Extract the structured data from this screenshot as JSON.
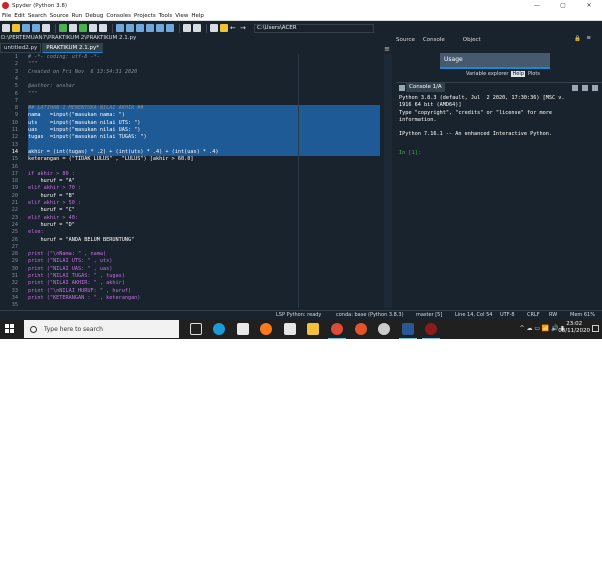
{
  "window": {
    "title": "Spyder (Python 3.8)",
    "minimize": "—",
    "maximize": "▢",
    "close": "✕"
  },
  "menu": [
    "File",
    "Edit",
    "Search",
    "Source",
    "Run",
    "Debug",
    "Consoles",
    "Projects",
    "Tools",
    "View",
    "Help"
  ],
  "toolbar": {
    "path": "C:\\Users\\ACER",
    "back": "←",
    "forward": "→"
  },
  "editor": {
    "file_path": "D:\\PERTEMUAN7\\PRAKTIKUM 2\\PRAKTIKUM 2.1.py",
    "tabs": [
      {
        "label": "untitled2.py",
        "close": "×"
      },
      {
        "label": "PRAKTIKUM 2.1.py*",
        "close": "×"
      }
    ],
    "menu_icon": "≡",
    "lines": [
      "# -*- coding: utf-8 -*-",
      "\"\"\"",
      "Created on Fri Nov  6 13:54:31 2020",
      "",
      "@author: anshar",
      "\"\"\"",
      "",
      "## LATIHAN 1 MENENTUKA NILAI AKHIR ##",
      "nama   =input(\"masukan nama: \")",
      "uts    =input(\"masukan nilai UTS: \")",
      "uas    =input(\"masukan nilai UAS: \")",
      "tugas  =input(\"masukan nilai TUGAS: \")",
      "",
      "akhir = (int(tugas) * .2) + (int(uts) * .4) + (int(uas) * .4)",
      "keterangan = (\"TIDAK LULUS\" , \"LULUS\") [akhir > 60.0]",
      "",
      "if akhir > 80 :",
      "    huruf = \"A\"",
      "elif akhir > 70 :",
      "    huruf = \"B\"",
      "elif akhir > 50 :",
      "    huruf = \"C\"",
      "elif akhir > 40:",
      "    huruf = \"D\"",
      "else:",
      "    huruf = \"ANDA BELUM BERUNTUNG\"",
      "",
      "print (\"\\nNama: \" , nama)",
      "print (\"NILAI UTS: \" , uts)",
      "print (\"NILAI UAS: \" , uas)",
      "print (\"NILAI TUGAS: \" , tugas)",
      "print (\"NILAI AKHIR: \" , akhir)",
      "print (\"\\nNILAI HURUF: \" , huruf)",
      "print (\"KETERANGAN : \" , keterangan)",
      ""
    ],
    "line_numbers": [
      "1",
      "2",
      "3",
      "4",
      "5",
      "6",
      "7",
      "8",
      "9",
      "10",
      "11",
      "12",
      "13",
      "14",
      "15",
      "16",
      "17",
      "18",
      "19",
      "20",
      "21",
      "22",
      "23",
      "24",
      "25",
      "26",
      "27",
      "28",
      "29",
      "30",
      "31",
      "32",
      "33",
      "34",
      "35"
    ],
    "current_line": 14
  },
  "right_pane": {
    "tabs": [
      "Source",
      "Console",
      "Object"
    ],
    "lock": "🔒",
    "menu_icon": "≡",
    "usage": "Usage",
    "help_tabs": [
      "Variable explorer",
      "Help",
      "Plots"
    ]
  },
  "console": {
    "tab_label": "Console 1/A",
    "close": "×",
    "lines": [
      "Python 3.8.3 (default, Jul  2 2020, 17:30:36) [MSC v.",
      "1916 64 bit (AMD64)]",
      "Type \"copyright\", \"credits\" or \"license\" for more",
      "information.",
      "",
      "IPython 7.16.1 -- An enhanced Interactive Python.",
      ""
    ],
    "prompt": "In [1]:"
  },
  "status": {
    "lsp": "LSP Python: ready",
    "conda": "conda: base (Python 3.8.3)",
    "git": "master [5]",
    "position": "Line 14, Col 54",
    "encoding": "UTF-8",
    "eol": "CRLF",
    "rw": "RW",
    "mem": "Mem 61%"
  },
  "taskbar": {
    "search_placeholder": "Type here to search",
    "time": "23:02",
    "date": "08/11/2020"
  },
  "colors": {
    "background": "#19232d",
    "selection": "#1e5a96",
    "accent": "#148cd2"
  }
}
